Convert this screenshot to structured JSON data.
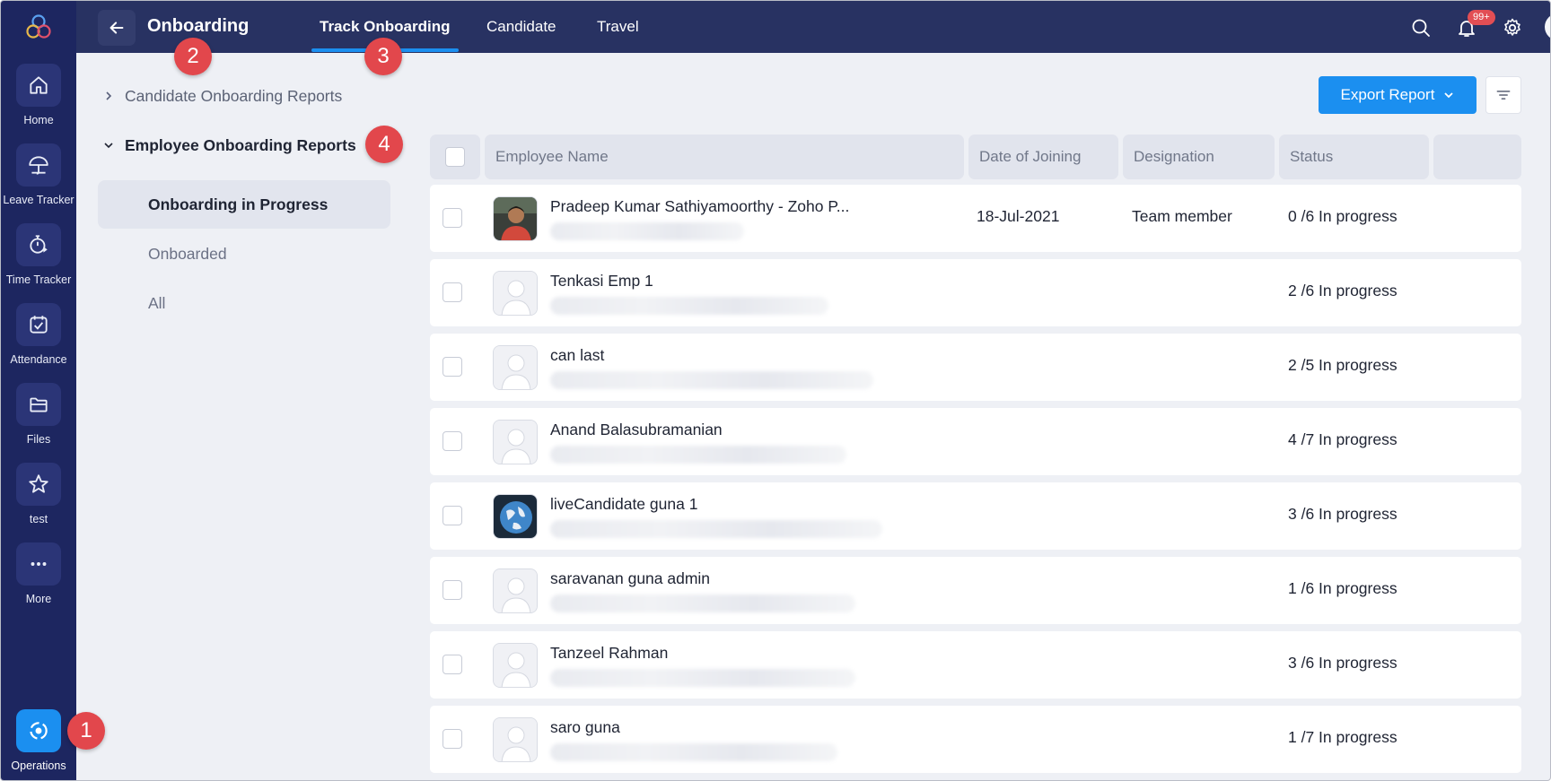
{
  "rail": {
    "items": [
      {
        "label": "Home",
        "icon": "home-icon"
      },
      {
        "label": "Leave Tracker",
        "icon": "umbrella-icon"
      },
      {
        "label": "Time Tracker",
        "icon": "stopwatch-icon"
      },
      {
        "label": "Attendance",
        "icon": "calendar-check-icon"
      },
      {
        "label": "Files",
        "icon": "folder-icon"
      },
      {
        "label": "test",
        "icon": "star-icon"
      },
      {
        "label": "More",
        "icon": "more-dots-icon"
      }
    ],
    "operations": {
      "label": "Operations",
      "icon": "operations-icon"
    }
  },
  "header": {
    "module_title": "Onboarding",
    "tabs": [
      {
        "label": "Track Onboarding",
        "active": true
      },
      {
        "label": "Candidate",
        "active": false
      },
      {
        "label": "Travel",
        "active": false
      }
    ],
    "notification_badge": "99+"
  },
  "reports": {
    "groups": [
      {
        "label": "Candidate Onboarding Reports",
        "expanded": false
      },
      {
        "label": "Employee Onboarding Reports",
        "expanded": true
      }
    ],
    "subitems": [
      {
        "label": "Onboarding in Progress",
        "active": true
      },
      {
        "label": "Onboarded",
        "active": false
      },
      {
        "label": "All",
        "active": false
      }
    ]
  },
  "toolbar": {
    "export_label": "Export Report"
  },
  "table": {
    "columns": [
      "Employee Name",
      "Date of Joining",
      "Designation",
      "Status"
    ],
    "rows": [
      {
        "name": "Pradeep Kumar Sathiyamoorthy - Zoho P...",
        "doj": "18-Jul-2021",
        "designation": "Team member",
        "status": "0 /6 In progress",
        "photo": "person-photo"
      },
      {
        "name": "Tenkasi Emp 1",
        "doj": "",
        "designation": "",
        "status": "2 /6 In progress",
        "photo": "default-avatar"
      },
      {
        "name": "can last",
        "doj": "",
        "designation": "",
        "status": "2 /5 In progress",
        "photo": "default-avatar"
      },
      {
        "name": "Anand Balasubramanian",
        "doj": "",
        "designation": "",
        "status": "4 /7 In progress",
        "photo": "default-avatar"
      },
      {
        "name": "liveCandidate guna 1",
        "doj": "",
        "designation": "",
        "status": "3 /6 In progress",
        "photo": "globe-photo"
      },
      {
        "name": "saravanan guna admin",
        "doj": "",
        "designation": "",
        "status": "1 /6 In progress",
        "photo": "default-avatar"
      },
      {
        "name": "Tanzeel Rahman",
        "doj": "",
        "designation": "",
        "status": "3 /6 In progress",
        "photo": "default-avatar"
      },
      {
        "name": "saro guna",
        "doj": "",
        "designation": "",
        "status": "1 /7 In progress",
        "photo": "default-avatar"
      }
    ]
  },
  "markers": [
    "1",
    "2",
    "3",
    "4"
  ],
  "colors": {
    "rail": "#1d2660",
    "topbar": "#283262",
    "accent": "#1b8ff0",
    "marker": "#e2474c"
  }
}
